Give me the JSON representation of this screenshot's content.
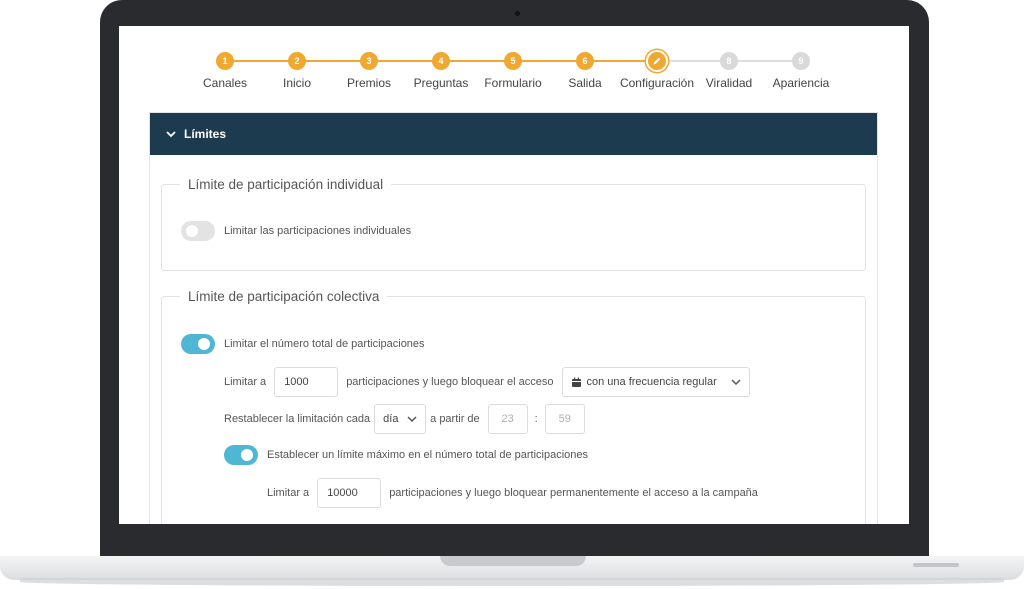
{
  "stepper": {
    "steps": [
      {
        "number": "1",
        "label": "Canales",
        "state": "done"
      },
      {
        "number": "2",
        "label": "Inicio",
        "state": "done"
      },
      {
        "number": "3",
        "label": "Premios",
        "state": "done"
      },
      {
        "number": "4",
        "label": "Preguntas",
        "state": "done"
      },
      {
        "number": "5",
        "label": "Formulario",
        "state": "done"
      },
      {
        "number": "6",
        "label": "Salida",
        "state": "done"
      },
      {
        "number": "",
        "label": "Configuración",
        "state": "current",
        "icon": "pencil-icon"
      },
      {
        "number": "8",
        "label": "Viralidad",
        "state": "todo"
      },
      {
        "number": "9",
        "label": "Apariencia",
        "state": "todo"
      }
    ],
    "colors": {
      "done": "#f0a830",
      "todo": "#d9d9d9"
    }
  },
  "panel": {
    "title": "Límites",
    "header_color": "#1d3b4f",
    "individual": {
      "legend": "Límite de participación individual",
      "toggle_label": "Limitar las participaciones individuales",
      "toggle_on": false
    },
    "collective": {
      "legend": "Límite de participación colectiva",
      "toggle_label": "Limitar el número total de participaciones",
      "toggle_on": true,
      "limit_prefix": "Limitar a",
      "limit_value": "1000",
      "limit_suffix": "participaciones y luego bloquear el acceso",
      "frequency_value": "con una frecuencia regular",
      "reset_prefix": "Restablecer la limitación cada",
      "reset_unit": "día",
      "reset_from": "a partir de",
      "hour_placeholder": "23",
      "time_separator": ":",
      "minute_placeholder": "59",
      "max_toggle_label": "Establecer un límite máximo en el número total de participaciones",
      "max_toggle_on": true,
      "max_prefix": "Limitar a",
      "max_value": "10000",
      "max_suffix": "participaciones y luego bloquear permanentemente el acceso a la campaña"
    }
  },
  "accent_color": "#4fb6d4"
}
